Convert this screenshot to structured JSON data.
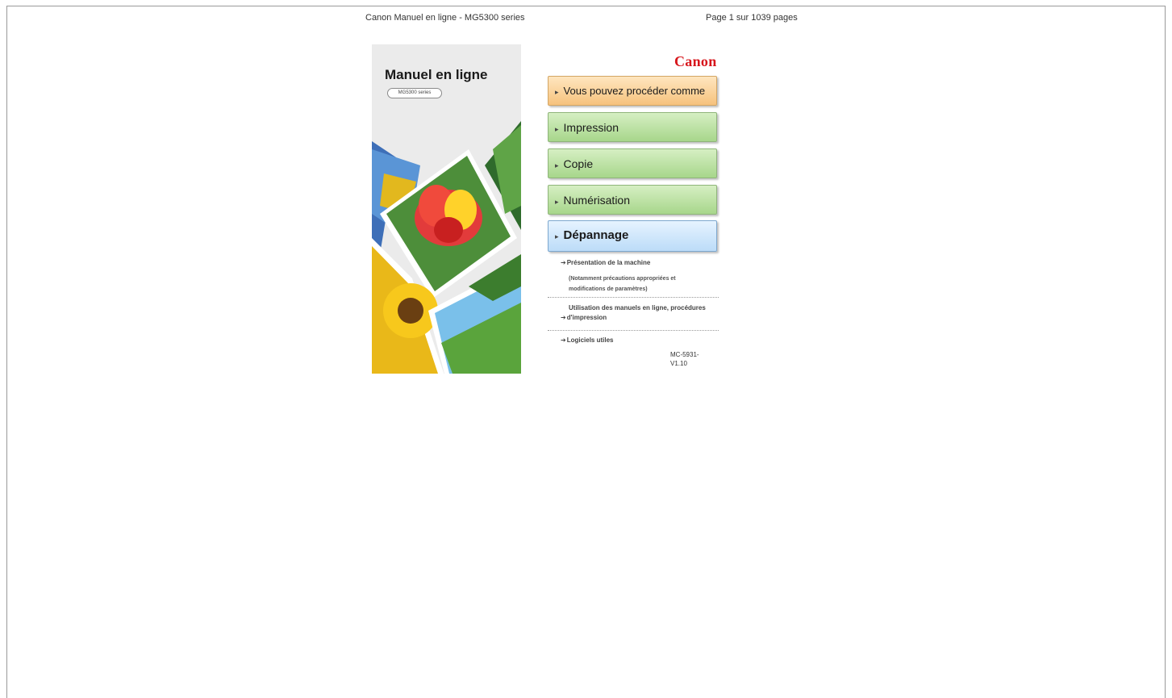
{
  "header": {
    "left": "Canon Manuel en ligne - MG5300 series",
    "right": "Page 1 sur 1039 pages"
  },
  "cover": {
    "title": "Manuel en ligne",
    "model": "MG5300 series"
  },
  "brand": {
    "logo": "Canon",
    "logo_color": "#d7161c"
  },
  "nav": {
    "items": [
      {
        "label": "Vous pouvez procéder comme suit",
        "color": "#f6c27d"
      },
      {
        "label": "Impression",
        "color": "#a7d68b"
      },
      {
        "label": "Copie",
        "color": "#a7d68b"
      },
      {
        "label": "Numérisation",
        "color": "#a7d68b"
      },
      {
        "label": "Dépannage",
        "color": "#bcdcf8"
      }
    ]
  },
  "links": {
    "machine": "Présentation de la machine",
    "machine_note_1": "(Notamment précautions appropriées et",
    "machine_note_2": "modifications de paramètres)",
    "manuals_1": "Utilisation des manuels en ligne, procédures",
    "manuals_2": "d'impression",
    "software": "Logiciels utiles"
  },
  "version": {
    "line1": "MC-5931-",
    "line2": "V1.10"
  }
}
